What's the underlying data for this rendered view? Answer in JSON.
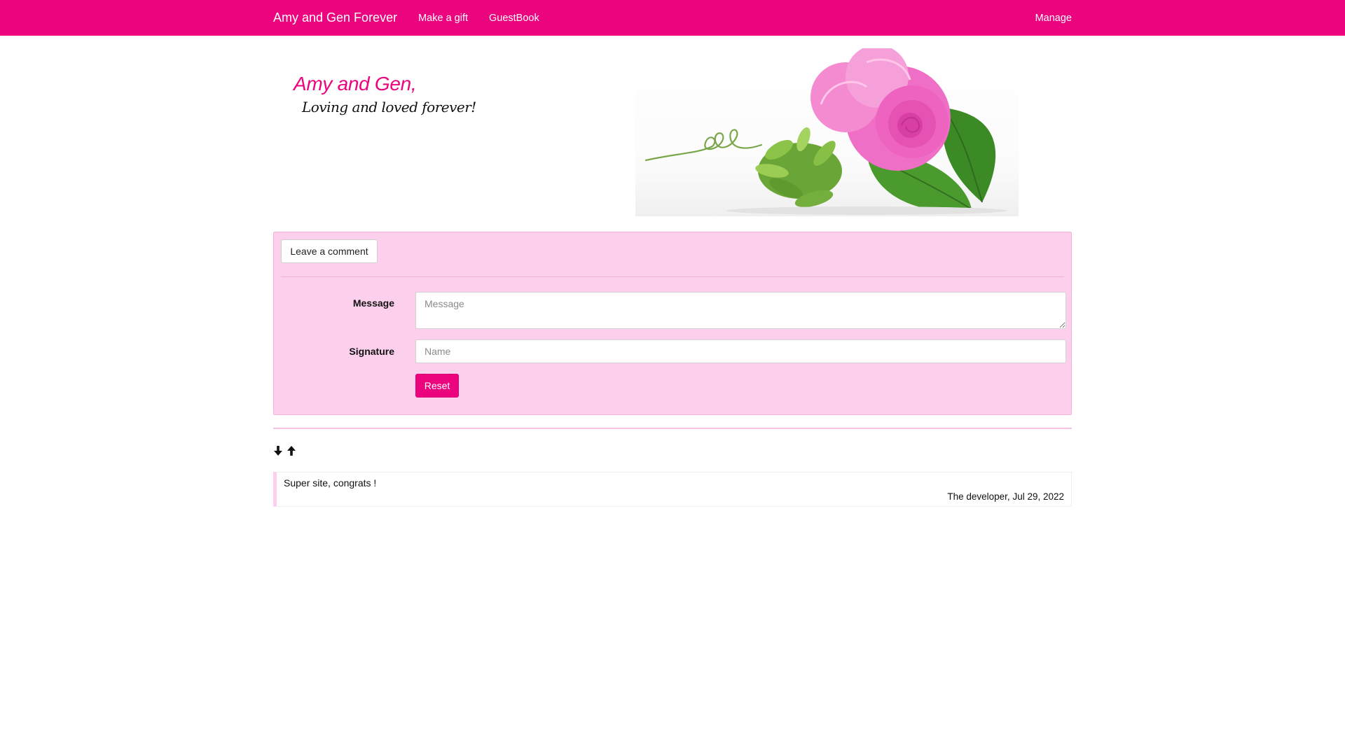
{
  "navbar": {
    "brand": "Amy and Gen Forever",
    "links": [
      {
        "label": "Make a gift"
      },
      {
        "label": "GuestBook"
      }
    ],
    "manage_label": "Manage",
    "background_color": "#ec047e"
  },
  "header": {
    "title": "Amy and Gen,",
    "subtitle": "Loving and loved forever!",
    "image_icon": "pink-rose-image"
  },
  "comment_form": {
    "leave_comment_label": "Leave a comment",
    "message_label": "Message",
    "message_placeholder": "Message",
    "message_value": "",
    "signature_label": "Signature",
    "signature_placeholder": "Name",
    "signature_value": "",
    "reset_label": "Reset",
    "panel_color": "#fcd0ec",
    "accent_color": "#ec047e"
  },
  "sort": {
    "down_icon": "arrow-down-icon",
    "up_icon": "arrow-up-icon"
  },
  "comments": [
    {
      "text": "Super site, congrats !",
      "meta": "The developer, Jul 29, 2022"
    }
  ]
}
